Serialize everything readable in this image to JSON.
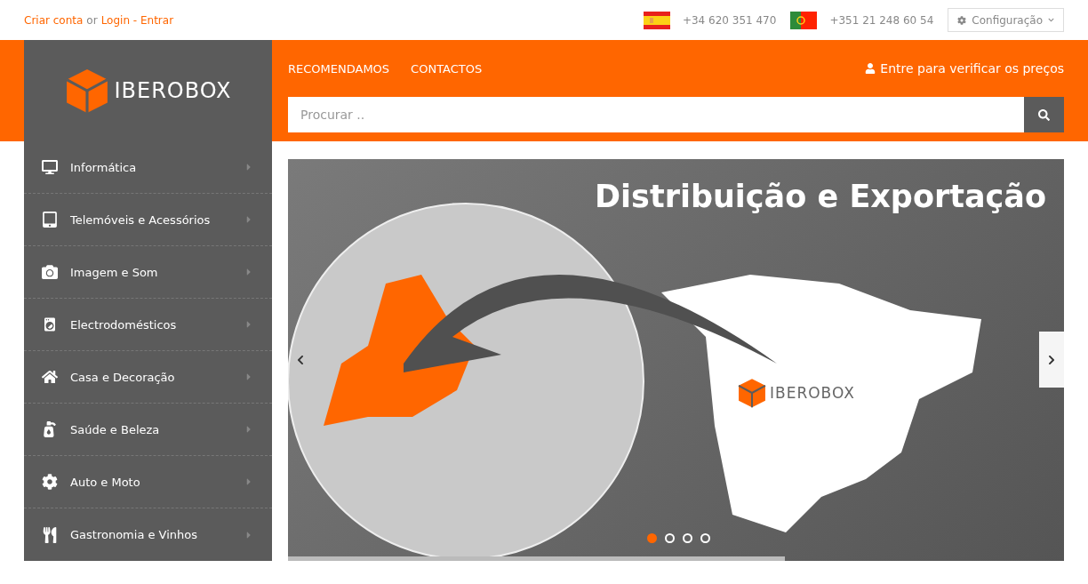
{
  "top_bar": {
    "account_links": [
      {
        "kind": "link",
        "text": "Criar conta"
      },
      {
        "kind": "plain",
        "text": "or"
      },
      {
        "kind": "link",
        "text": "Login - Entrar"
      }
    ],
    "phones": [
      {
        "number": "+34 620 351 470"
      },
      {
        "number": "+351 21 248 60 54"
      }
    ],
    "settings": {
      "label": "Configuração"
    }
  },
  "header": {
    "logo": {
      "text": "IBEROBOX"
    },
    "nav": [
      "RECOMENDAMOS",
      "CONTACTOS"
    ],
    "login_prompt": "Entre para verificar os preços",
    "search": {
      "placeholder": "Procurar .."
    }
  },
  "categories": [
    {
      "label": "Informática"
    },
    {
      "label": "Telemóveis e Acessórios"
    },
    {
      "label": "Imagem e Som"
    },
    {
      "label": "Electrodomésticos"
    },
    {
      "label": "Casa e Decoração"
    },
    {
      "label": "Saúde e Beleza"
    },
    {
      "label": "Auto e Moto"
    },
    {
      "label": "Gastronomia e Vinhos"
    }
  ],
  "banner": {
    "headline": "Distribuição e Exportação",
    "logo_text": "IBEROBOX",
    "dots": [
      {
        "selected": true
      },
      {
        "selected": false
      },
      {
        "selected": false
      },
      {
        "selected": false
      }
    ],
    "progress": {
      "level": 0.64
    }
  }
}
